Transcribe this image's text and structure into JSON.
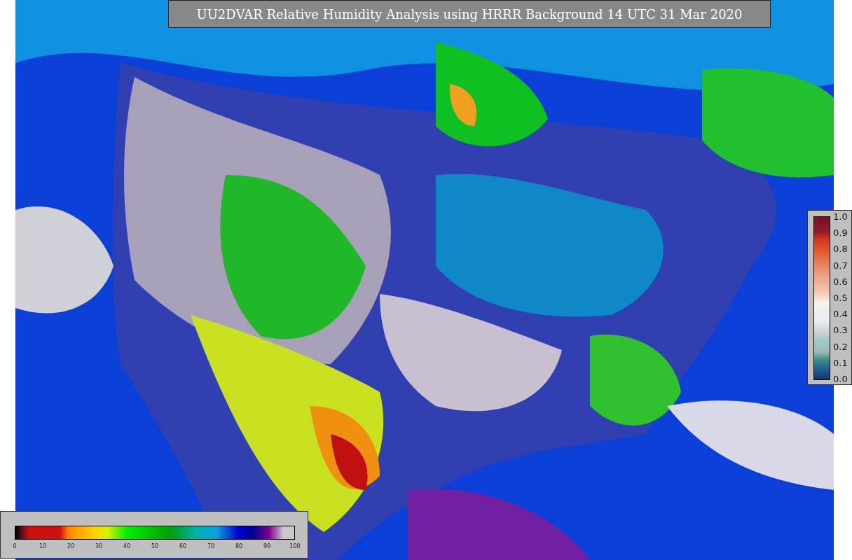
{
  "title": "UU2DVAR Relative Humidity Analysis using HRRR Background 14 UTC 31 Mar 2020",
  "humidity_scale": {
    "ticks": [
      "0",
      "10",
      "20",
      "30",
      "40",
      "50",
      "60",
      "70",
      "80",
      "90",
      "100"
    ]
  },
  "ratio_scale": {
    "ticks": [
      "1.0",
      "0.9",
      "0.8",
      "0.7",
      "0.6",
      "0.5",
      "0.4",
      "0.3",
      "0.2",
      "0.1",
      "0.0"
    ]
  }
}
